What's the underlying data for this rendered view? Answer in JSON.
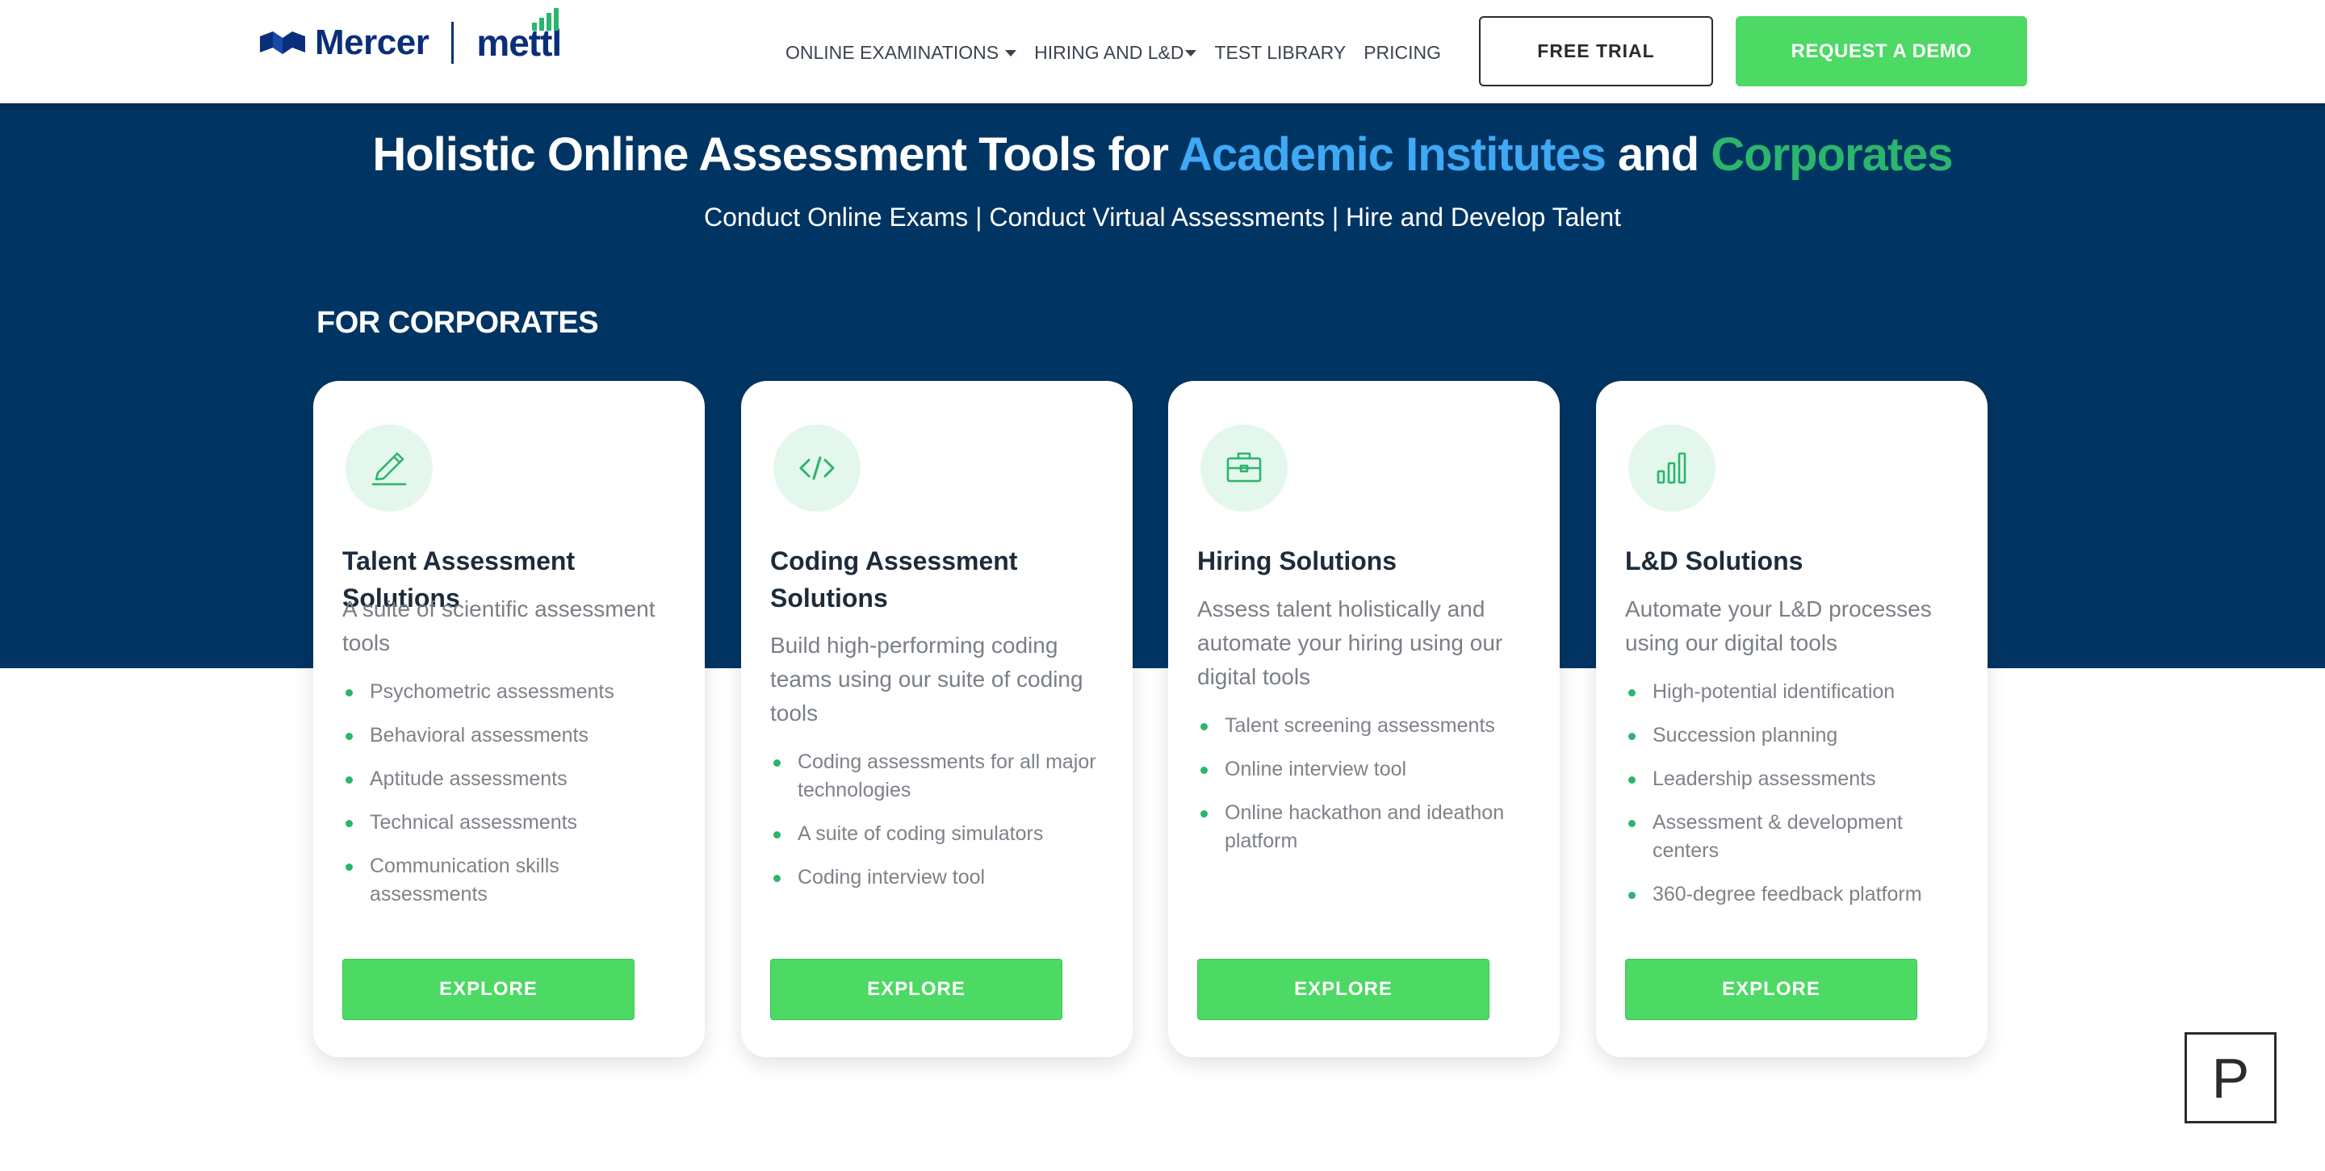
{
  "header": {
    "logo_left": "Mercer",
    "logo_right": "mettl",
    "nav": [
      {
        "label": "ONLINE EXAMINATIONS",
        "dropdown": true
      },
      {
        "label": "HIRING AND L&D",
        "dropdown": true
      },
      {
        "label": "TEST LIBRARY",
        "dropdown": false
      },
      {
        "label": "PRICING",
        "dropdown": false
      }
    ],
    "free_trial": "FREE TRIAL",
    "request_demo": "REQUEST A DEMO"
  },
  "hero": {
    "title_prefix": "Holistic Online Assessment Tools for ",
    "title_academic": "Academic Institutes",
    "title_and": " and ",
    "title_corporates": "Corporates",
    "subtitle": "Conduct Online Exams | Conduct Virtual Assessments | Hire and Develop Talent",
    "section_label": "FOR CORPORATES"
  },
  "cards": [
    {
      "icon": "pencil-icon",
      "title": "Talent Assessment Solutions",
      "description": "A suite of scientific assessment tools",
      "items": [
        "Psychometric assessments",
        "Behavioral assessments",
        "Aptitude assessments",
        "Technical assessments",
        "Communication skills assessments"
      ],
      "button": "EXPLORE"
    },
    {
      "icon": "code-icon",
      "title": "Coding Assessment Solutions",
      "description": "Build high-performing coding teams using our suite of coding tools",
      "items": [
        "Coding assessments for all major technologies",
        "A suite of coding simulators",
        "Coding interview tool"
      ],
      "button": "EXPLORE"
    },
    {
      "icon": "briefcase-icon",
      "title": "Hiring Solutions",
      "description": "Assess talent holistically and automate your hiring using our digital tools",
      "items": [
        "Talent screening assessments",
        "Online interview tool",
        "Online hackathon and ideathon platform"
      ],
      "button": "EXPLORE"
    },
    {
      "icon": "bar-chart-icon",
      "title": "L&D Solutions",
      "description": "Automate your L&D processes using our digital tools",
      "items": [
        "High-potential identification",
        "Succession planning",
        "Leadership assessments",
        "Assessment & development centers",
        "360-degree feedback platform"
      ],
      "button": "EXPLORE"
    }
  ],
  "widget": {
    "label": "P"
  },
  "colors": {
    "hero_bg": "#003563",
    "accent_green": "#4cd964",
    "highlight_blue": "#3fa9f5",
    "highlight_green": "#2bb56d",
    "brand_navy": "#0a2f7a"
  }
}
